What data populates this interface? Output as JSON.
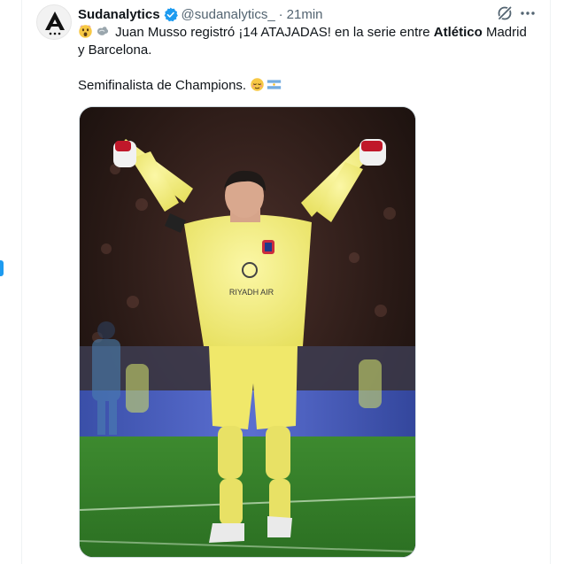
{
  "tweet": {
    "author_name": "Sudanalytics",
    "handle": "@sudanalytics_",
    "separator": "·",
    "time": "21min",
    "text_line1_pre": "Juan Musso registró ¡14 ATAJADAS! en la serie entre ",
    "text_line1_bold": "Atlético",
    "text_line1_post": " Madrid",
    "text_line2": "y Barcelona.",
    "text_line3": "Semifinalista de Champions.",
    "emojis": [
      "astonished-face-emoji",
      "dashing-away-emoji",
      "relieved-face-emoji",
      "argentina-flag-emoji"
    ]
  },
  "media": {
    "shirt_sponsor": "RIYADH AIR",
    "accent_color": "#f1ec72"
  },
  "colors": {
    "text": "#0f1419",
    "muted": "#536471",
    "verified": "#1d9bf0"
  }
}
